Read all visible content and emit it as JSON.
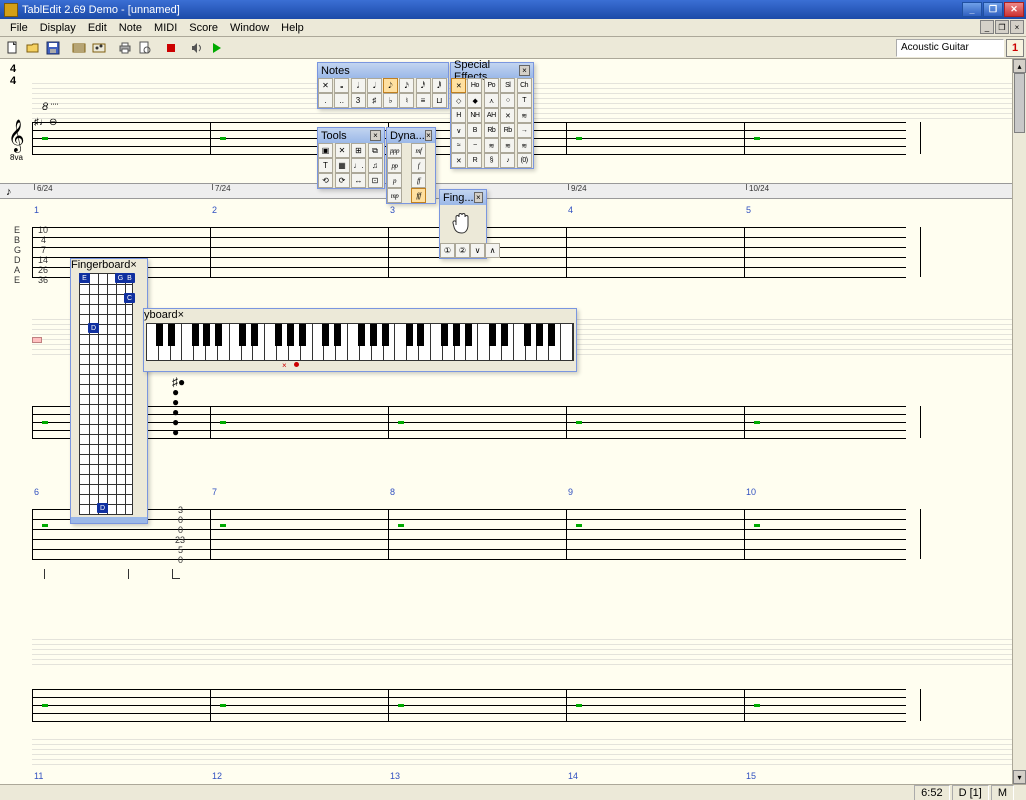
{
  "title": "TablEdit 2.69 Demo - [unnamed]",
  "menu": [
    "File",
    "Display",
    "Edit",
    "Note",
    "MIDI",
    "Score",
    "Window",
    "Help"
  ],
  "instrument": {
    "name": "Acoustic Guitar",
    "num": "1"
  },
  "timesig": {
    "top": "4",
    "bot": "4"
  },
  "ruler": {
    "positions": [
      "6/24",
      "7/24",
      "",
      "9/24",
      "10/24"
    ]
  },
  "string_labels": [
    "E",
    "B",
    "G",
    "D",
    "A",
    "E"
  ],
  "string_frets": [
    "10",
    "4",
    "7",
    "14",
    "26",
    "36"
  ],
  "measure_row1": [
    "1",
    "2",
    "3",
    "4",
    "5"
  ],
  "measure_row2": [
    "6",
    "7",
    "8",
    "9",
    "10"
  ],
  "measure_row3": [
    "11",
    "12",
    "13",
    "14",
    "15"
  ],
  "tab_col": [
    "3",
    "0",
    "0",
    "23",
    "5",
    "0"
  ],
  "eight_va": "8va",
  "palettes": {
    "notes": {
      "title": "Notes",
      "row1": [
        "✕",
        "𝅝",
        "𝅗𝅥",
        "𝅘𝅥",
        "𝅘𝅥𝅮",
        "𝅘𝅥𝅯",
        "𝅘𝅥𝅰",
        "𝅘𝅥𝅱"
      ],
      "row2": [
        ".",
        "..",
        "3",
        "♯",
        "♭",
        "♮",
        "≡",
        "⊔"
      ]
    },
    "special": {
      "title": "Special Effects",
      "rows": [
        [
          "✕",
          "Ho",
          "Po",
          "Sl",
          "Ch"
        ],
        [
          "◇",
          "◆",
          "⋏",
          "○",
          "T"
        ],
        [
          "H",
          "NH",
          "AH",
          "✕",
          "≋"
        ],
        [
          "∨",
          "B",
          "Rb",
          "Rb",
          "→"
        ],
        [
          "≈",
          "~",
          "≋",
          "≋",
          "≋"
        ],
        [
          "✕",
          "R",
          "§",
          "♪",
          "(0)"
        ]
      ]
    },
    "tools": {
      "title": "Tools",
      "rows": [
        [
          "▣",
          "✕",
          "⊞",
          "⧉"
        ],
        [
          "T",
          "▦",
          "♩.",
          "♫"
        ],
        [
          "⟲",
          "⟳",
          "↔",
          "⊡"
        ]
      ]
    },
    "dyna": {
      "title": "Dyna...",
      "rows": [
        [
          "ppp",
          "mf"
        ],
        [
          "pp",
          "f"
        ],
        [
          "p",
          "ff"
        ],
        [
          "mp",
          "fff"
        ]
      ]
    },
    "fing": {
      "title": "Fing...",
      "footer": [
        "①",
        "②",
        "∨",
        "∧"
      ]
    }
  },
  "fingerboard": {
    "title": "Fingerboard",
    "markers": [
      {
        "str": 0,
        "fret": 0,
        "lab": "E"
      },
      {
        "str": 4,
        "fret": 0,
        "lab": "G"
      },
      {
        "str": 5,
        "fret": 0,
        "lab": "B"
      },
      {
        "str": 5,
        "fret": 2,
        "lab": "C"
      },
      {
        "str": 1,
        "fret": 5,
        "lab": "D"
      },
      {
        "str": 2,
        "fret": 23,
        "lab": "D"
      }
    ]
  },
  "keyboard": {
    "title": "Keyboard"
  },
  "status": {
    "time": "6:52",
    "note": "D [1]",
    "mode": "M"
  }
}
